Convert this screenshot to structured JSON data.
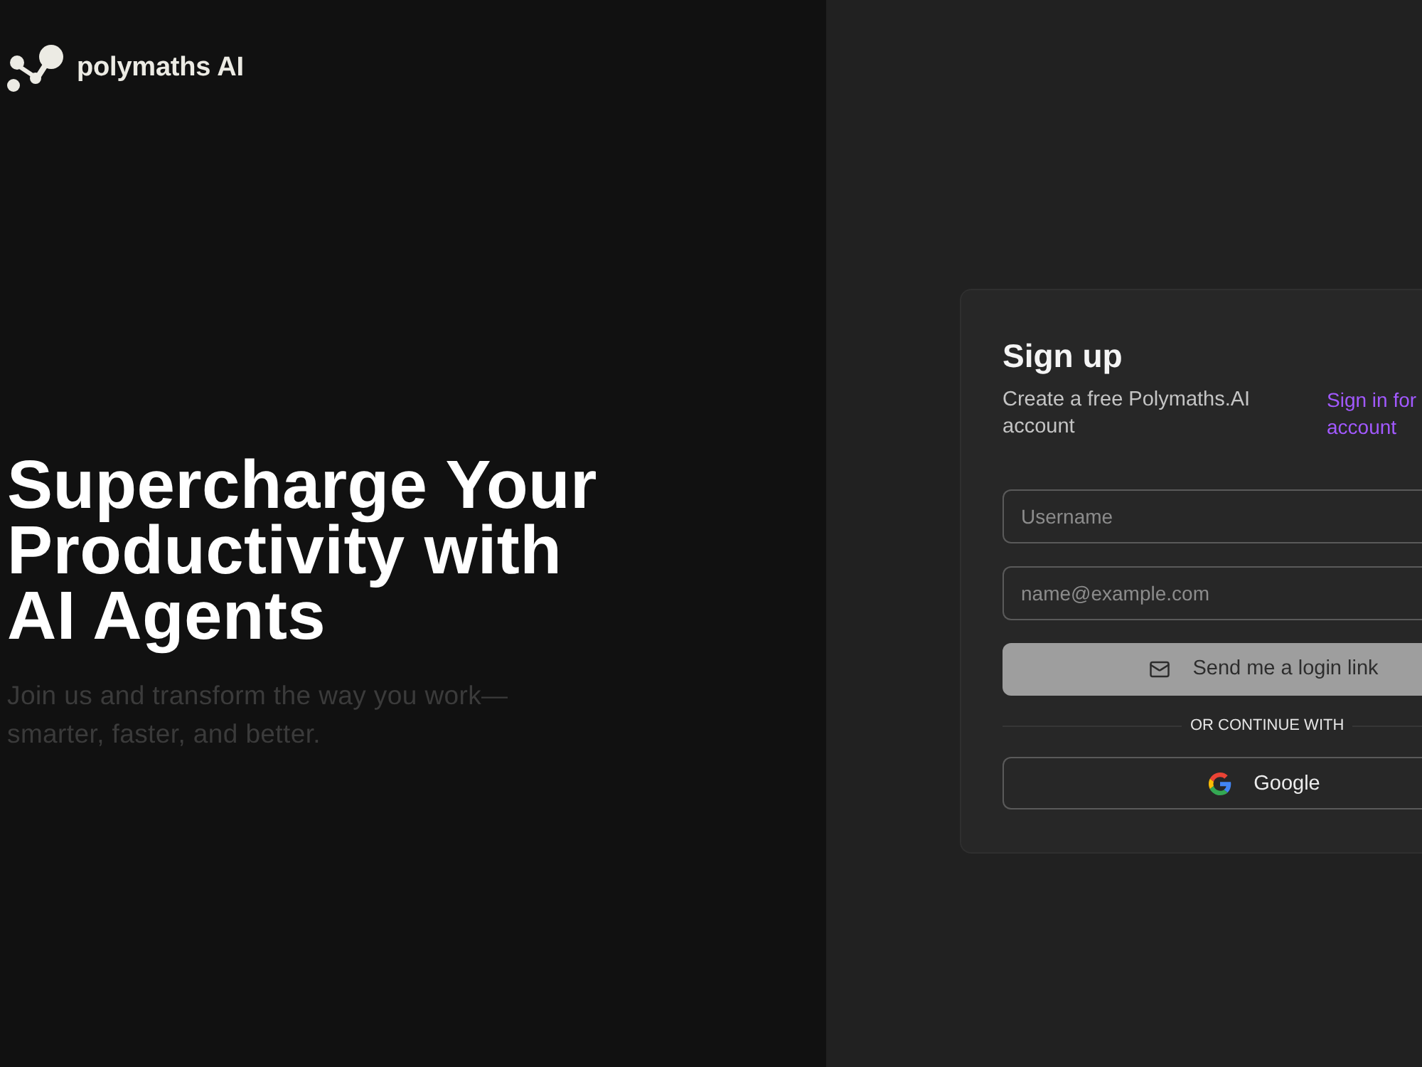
{
  "brand": {
    "name": "polymaths AI"
  },
  "hero": {
    "headline": "Supercharge Your Productivity with AI Agents",
    "tagline": "Join us and transform the way you work—smarter, faster, and better."
  },
  "signup": {
    "title": "Sign up",
    "description": "Create a free Polymaths.AI account",
    "signin_link": "Sign in for account",
    "fields": [
      {
        "placeholder": "Username"
      },
      {
        "placeholder": "name@example.com"
      }
    ],
    "submit_button": {
      "label": "Send me a login link",
      "disabled": true
    },
    "divider": "OR CONTINUE WITH",
    "providers": [
      {
        "kind": "google",
        "label": "Google"
      }
    ]
  }
}
